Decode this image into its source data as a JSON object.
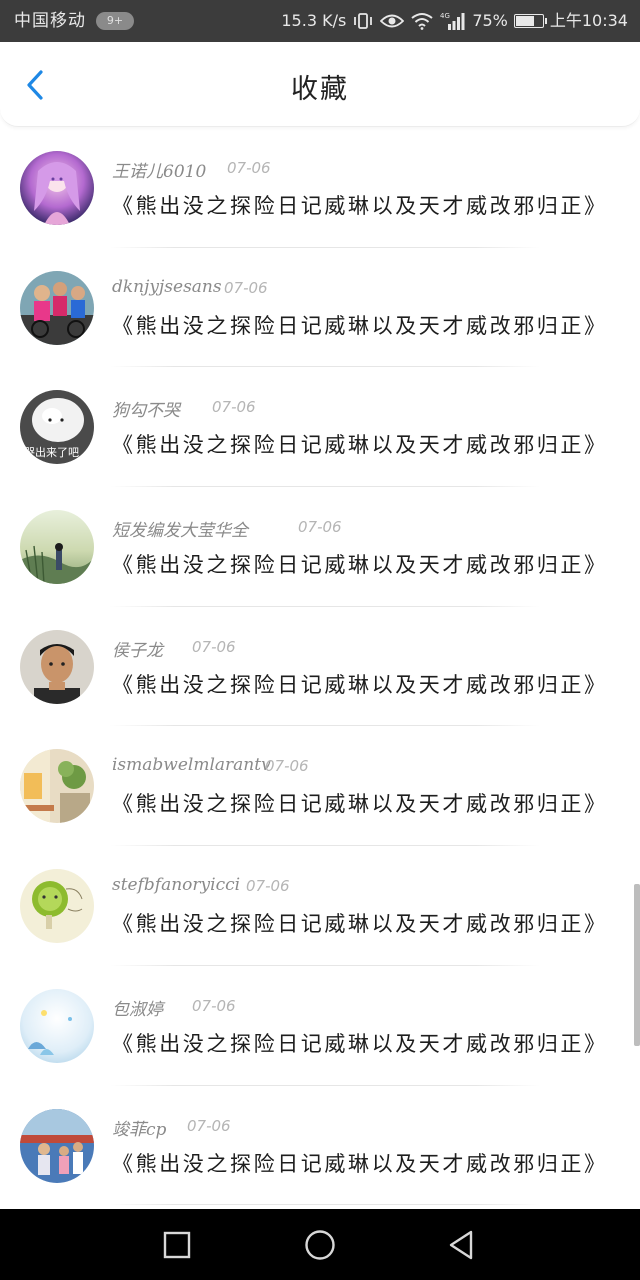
{
  "status_bar": {
    "carrier": "中国移动",
    "notif_badge": "9+",
    "net_speed": "15.3 K/s",
    "network_type": "4G",
    "battery_percent": "75%",
    "battery_level": 0.75,
    "time": "上午10:34",
    "icons": [
      "vibrate-icon",
      "eye-icon",
      "wifi-icon",
      "signal-icon",
      "battery-icon"
    ]
  },
  "header": {
    "title": "收藏",
    "back_icon": "chevron-left-icon",
    "accent_color": "#1e88e5"
  },
  "favorites": [
    {
      "user": "王诺儿6010",
      "date": "07-06",
      "title": "《熊出没之探险日记威琳以及天才威改邪归正》"
    },
    {
      "user": "dknjyjsesans",
      "date": "07-06",
      "title": "《熊出没之探险日记威琳以及天才威改邪归正》"
    },
    {
      "user": "狗勾不哭",
      "date": "07-06",
      "title": "《熊出没之探险日记威琳以及天才威改邪归正》",
      "avatar_text": "哭出来了吧"
    },
    {
      "user": "短发编发大莹华全",
      "date": "07-06",
      "title": "《熊出没之探险日记威琳以及天才威改邪归正》"
    },
    {
      "user": "侯子龙",
      "date": "07-06",
      "title": "《熊出没之探险日记威琳以及天才威改邪归正》"
    },
    {
      "user": "ismabwelmlarantv",
      "date": "07-06",
      "title": "《熊出没之探险日记威琳以及天才威改邪归正》"
    },
    {
      "user": "stefbfanoryicci",
      "date": "07-06",
      "title": "《熊出没之探险日记威琳以及天才威改邪归正》"
    },
    {
      "user": "包淑婷",
      "date": "07-06",
      "title": "《熊出没之探险日记威琳以及天才威改邪归正》"
    },
    {
      "user": "竣菲cp",
      "date": "07-06",
      "title": "《熊出没之探险日记威琳以及天才威改邪归正》"
    }
  ],
  "nav_bar": {
    "buttons": [
      "recent-apps-icon",
      "home-icon",
      "back-icon"
    ]
  }
}
